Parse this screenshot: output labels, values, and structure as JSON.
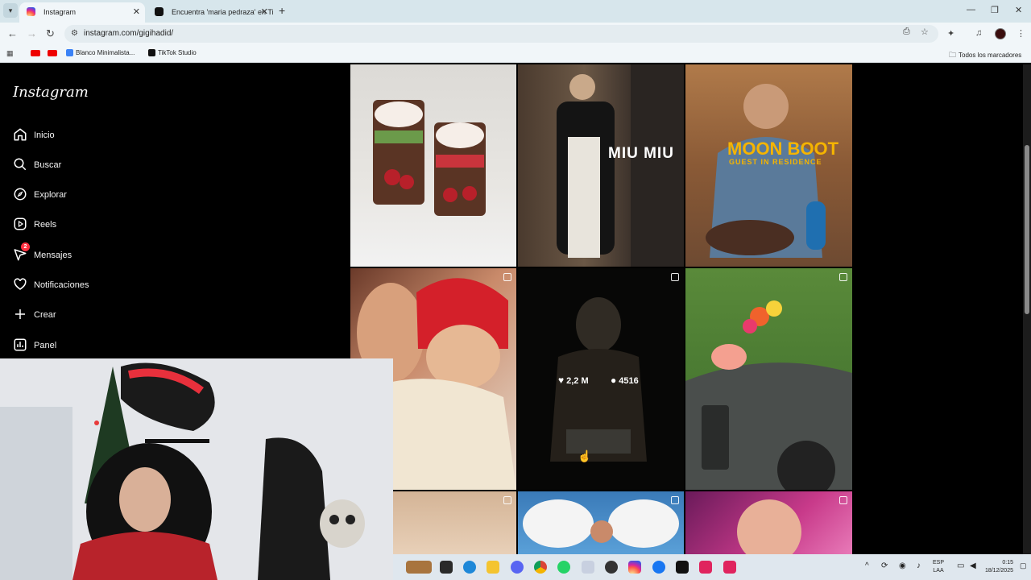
{
  "browser": {
    "tabs": [
      {
        "title": "Instagram",
        "active": true
      },
      {
        "title": "Encuentra 'maria pedraza' en TikTok",
        "active": false
      }
    ],
    "url": "instagram.com/gigihadid/",
    "bookmarks": [
      "Blanco Minimalista...",
      "TikTok Studio"
    ],
    "all_bookmarks": "Todos los marcadores"
  },
  "sidebar": {
    "logo": "Instagram",
    "items": [
      {
        "label": "Inicio",
        "icon": "home-icon"
      },
      {
        "label": "Buscar",
        "icon": "search-icon"
      },
      {
        "label": "Explorar",
        "icon": "compass-icon"
      },
      {
        "label": "Reels",
        "icon": "reels-icon"
      },
      {
        "label": "Mensajes",
        "icon": "messenger-icon",
        "badge": "2"
      },
      {
        "label": "Notificaciones",
        "icon": "heart-icon"
      },
      {
        "label": "Crear",
        "icon": "plus-icon"
      },
      {
        "label": "Panel",
        "icon": "chart-icon"
      }
    ]
  },
  "posts": {
    "p2_text": "MIU MIU",
    "p3_title": "MOON BOOT",
    "p3_sub": "GUEST IN RESIDENCE",
    "hover_likes": "2,2 M",
    "hover_comments": "4516"
  },
  "taskbar": {
    "lang_top": "ESP",
    "lang_bottom": "LAA",
    "time": "0:15",
    "date": "18/12/2025"
  },
  "colors": {
    "ig_bg": "#000000",
    "badge": "#ff3040",
    "browser_chrome": "#f1f6f9"
  }
}
